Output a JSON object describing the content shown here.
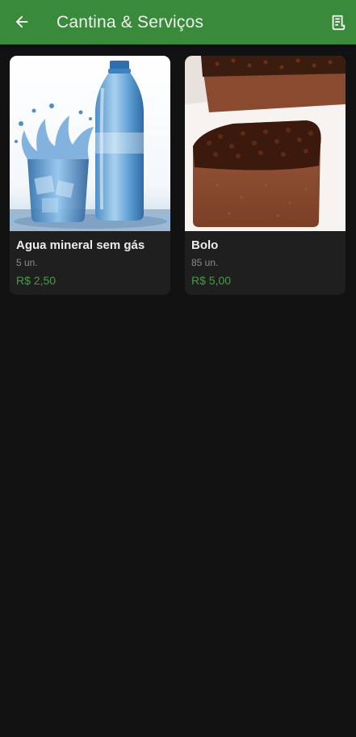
{
  "appbar": {
    "title": "Cantina & Serviços",
    "back_icon": "arrow-left-icon",
    "receipt_icon": "receipt-icon",
    "color": "#3a8a3c"
  },
  "products": [
    {
      "name": "Agua mineral sem gás",
      "quantity": "5 un.",
      "price": "R$ 2,50",
      "image": "water-bottle-glass-splash-image"
    },
    {
      "name": "Bolo",
      "quantity": "85 un.",
      "price": "R$ 5,00",
      "image": "chocolate-cake-sprinkles-image"
    }
  ],
  "colors": {
    "background": "#121212",
    "card": "#1f1f1f",
    "price": "#3fa043"
  }
}
